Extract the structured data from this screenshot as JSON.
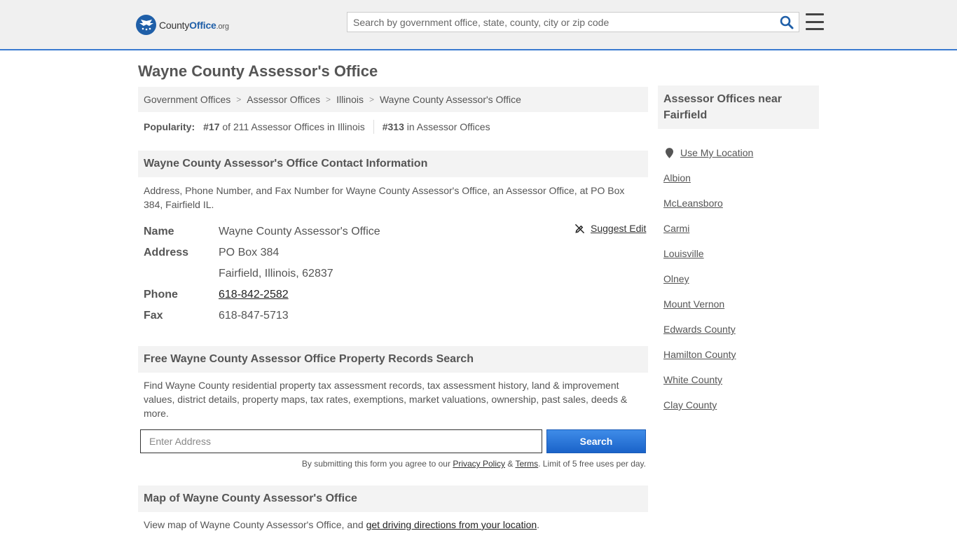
{
  "header": {
    "logo_county": "County",
    "logo_office": "Office",
    "logo_tld": ".org",
    "search_placeholder": "Search by government office, state, county, city or zip code"
  },
  "page": {
    "title": "Wayne County Assessor's Office"
  },
  "breadcrumb": [
    "Government Offices",
    "Assessor Offices",
    "Illinois",
    "Wayne County Assessor's Office"
  ],
  "breadcrumb_sep": ">",
  "popularity": {
    "label": "Popularity:",
    "state_rank": "#17",
    "state_text": "of 211 Assessor Offices in Illinois",
    "national_rank": "#313",
    "national_text": "in Assessor Offices"
  },
  "contact": {
    "heading": "Wayne County Assessor's Office Contact Information",
    "description": "Address, Phone Number, and Fax Number for Wayne County Assessor's Office, an Assessor Office, at PO Box 384, Fairfield IL.",
    "suggest_edit": "Suggest Edit",
    "name_label": "Name",
    "name": "Wayne County Assessor's Office",
    "address_label": "Address",
    "address_line1": "PO Box 384",
    "address_line2": "Fairfield, Illinois, 62837",
    "phone_label": "Phone",
    "phone": "618-842-2582",
    "fax_label": "Fax",
    "fax": "618-847-5713"
  },
  "records": {
    "heading": "Free Wayne County Assessor Office Property Records Search",
    "description": "Find Wayne County residential property tax assessment records, tax assessment history, land & improvement values, district details, property maps, tax rates, exemptions, market valuations, ownership, past sales, deeds & more.",
    "address_placeholder": "Enter Address",
    "search_label": "Search",
    "disclaimer_pre": "By submitting this form you agree to our ",
    "privacy": "Privacy Policy",
    "amp": " & ",
    "terms": "Terms",
    "disclaimer_post": ". Limit of 5 free uses per day."
  },
  "map": {
    "heading": "Map of Wayne County Assessor's Office",
    "description_pre": "View map of Wayne County Assessor's Office, and ",
    "directions_link": "get driving directions from your location",
    "description_post": "."
  },
  "aside": {
    "heading": "Assessor Offices near Fairfield",
    "use_location": "Use My Location",
    "links": [
      "Albion",
      "McLeansboro",
      "Carmi",
      "Louisville",
      "Olney",
      "Mount Vernon",
      "Edwards County",
      "Hamilton County",
      "White County",
      "Clay County"
    ]
  },
  "colors": {
    "brand_blue": "#1f5fa8",
    "header_border": "#3a7ad0",
    "button_blue": "#2a74d8",
    "section_bg": "#f3f3f3"
  },
  "icons": [
    "logo-eagle-icon",
    "search-icon",
    "hamburger-menu-icon",
    "edit-pencil-icon",
    "map-pin-icon"
  ]
}
